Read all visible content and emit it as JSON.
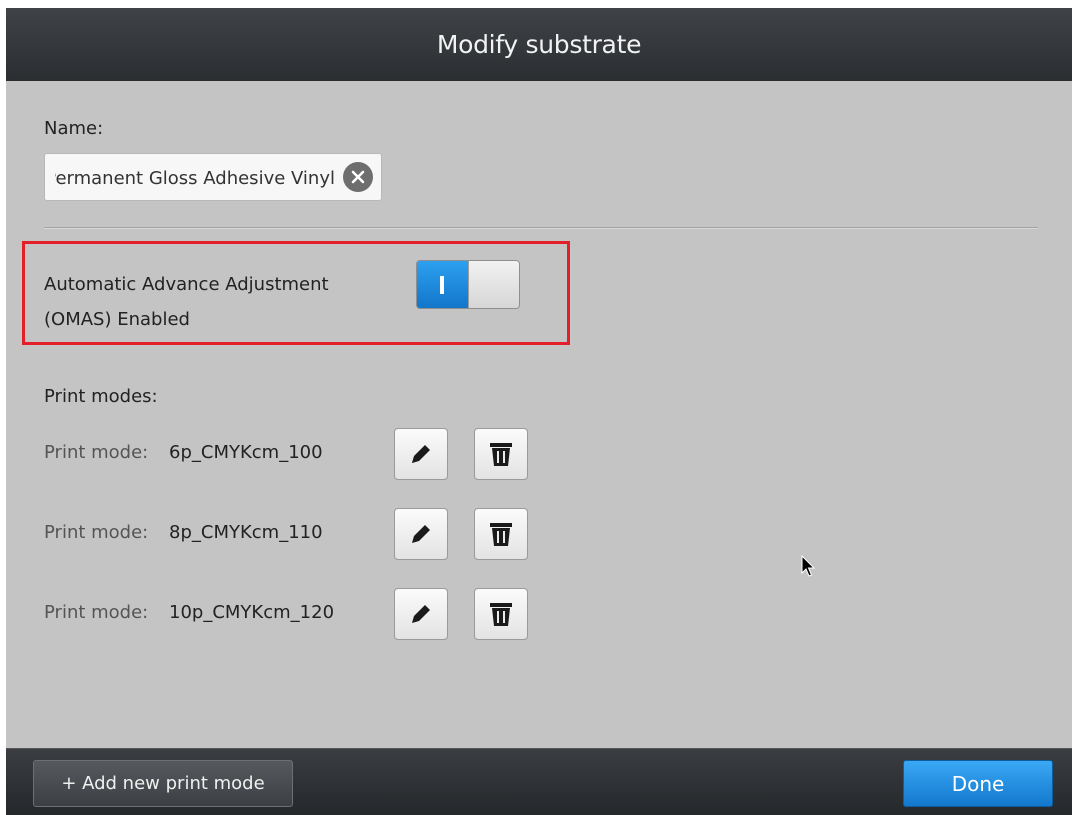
{
  "dialog": {
    "title": "Modify substrate"
  },
  "name": {
    "label": "Name:",
    "value": "Permanent Gloss Adhesive Vinyl",
    "clear_icon": "clear-circle-x-icon"
  },
  "omas": {
    "label_line1": "Automatic Advance Adjustment",
    "label_line2": "(OMAS) Enabled",
    "toggle_state": "on",
    "highlight_color": "#e3202a"
  },
  "print_modes": {
    "label": "Print modes:",
    "prefix": "Print mode:",
    "items": [
      {
        "name": "6p_CMYKcm_100"
      },
      {
        "name": "8p_CMYKcm_110"
      },
      {
        "name": "10p_CMYKcm_120"
      }
    ],
    "edit_icon": "pencil-icon",
    "delete_icon": "trash-icon"
  },
  "footer": {
    "add_label": "+ Add new print mode",
    "done_label": "Done"
  },
  "colors": {
    "accent": "#1e8ee0",
    "titlebar": "#33373a",
    "background": "#c4c4c4"
  }
}
